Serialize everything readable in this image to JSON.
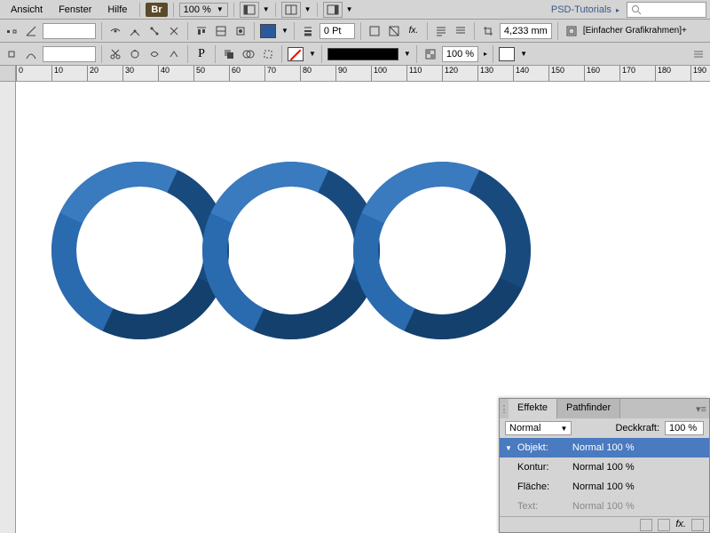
{
  "menu": {
    "view": "Ansicht",
    "window": "Fenster",
    "help": "Hilfe"
  },
  "br_badge": "Br",
  "zoom": "100 %",
  "psd_link": "PSD-Tutorials",
  "search_placeholder": "",
  "toolbar": {
    "pt_value": "0 Pt",
    "percent_value": "100 %",
    "mm_value": "4,233 mm",
    "frame_label": "[Einfacher Grafikrahmen]+"
  },
  "ruler": [
    "0",
    "10",
    "20",
    "30",
    "40",
    "50",
    "60",
    "70",
    "80",
    "90",
    "100",
    "110",
    "120",
    "130",
    "140",
    "150",
    "160",
    "170",
    "180",
    "190"
  ],
  "panel": {
    "tabs": {
      "effects": "Effekte",
      "pathfinder": "Pathfinder"
    },
    "blend_mode": "Normal",
    "opacity_label": "Deckkraft:",
    "opacity_value": "100 %",
    "rows": {
      "object": {
        "label": "Objekt:",
        "value": "Normal 100 %"
      },
      "stroke": {
        "label": "Kontur:",
        "value": "Normal 100 %"
      },
      "fill": {
        "label": "Fläche:",
        "value": "Normal 100 %"
      },
      "text": {
        "label": "Text:",
        "value": "Normal 100 %"
      }
    }
  }
}
